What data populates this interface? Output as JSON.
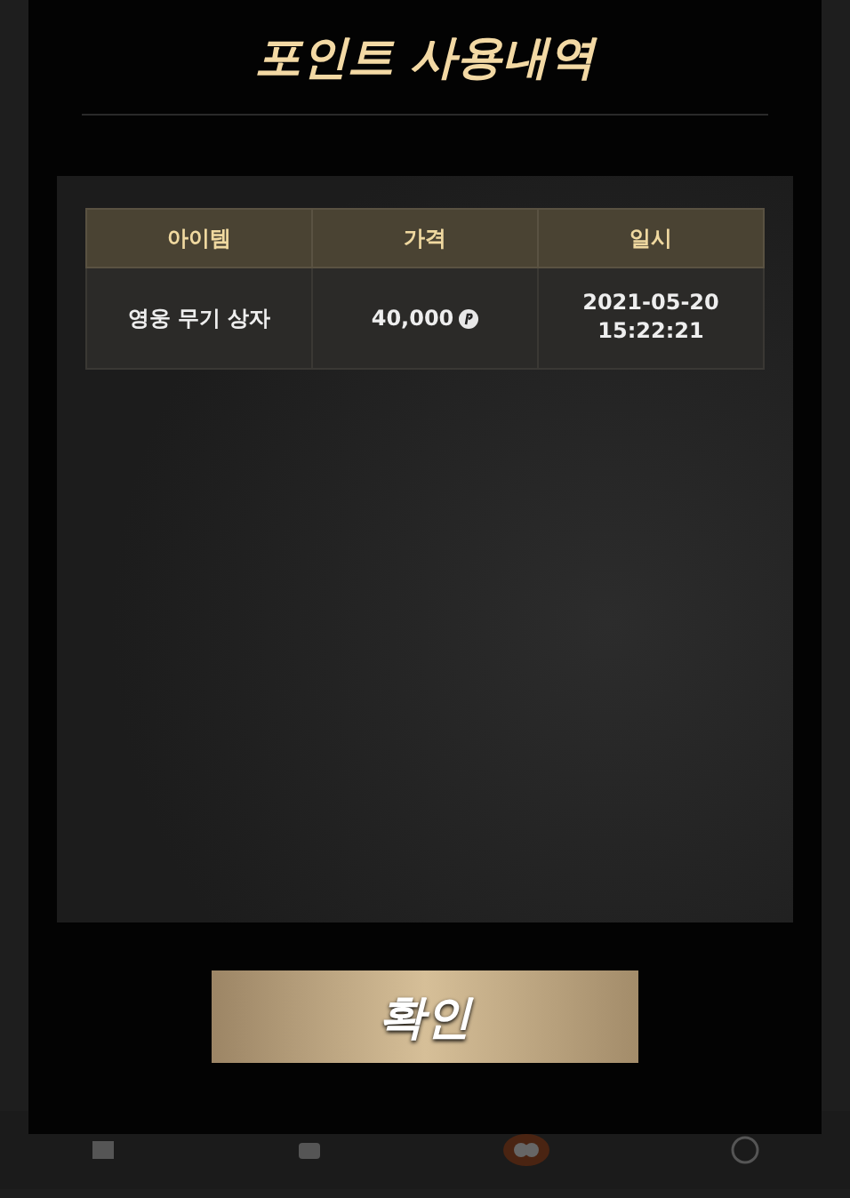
{
  "dialog": {
    "title": "포인트 사용내역",
    "table": {
      "columns": [
        "아이템",
        "가격",
        "일시"
      ],
      "rows": [
        {
          "item": "영웅 무기 상자",
          "price": "40,000",
          "date": "2021-05-20",
          "time": "15:22:21"
        }
      ]
    },
    "confirm_button": "확인"
  }
}
